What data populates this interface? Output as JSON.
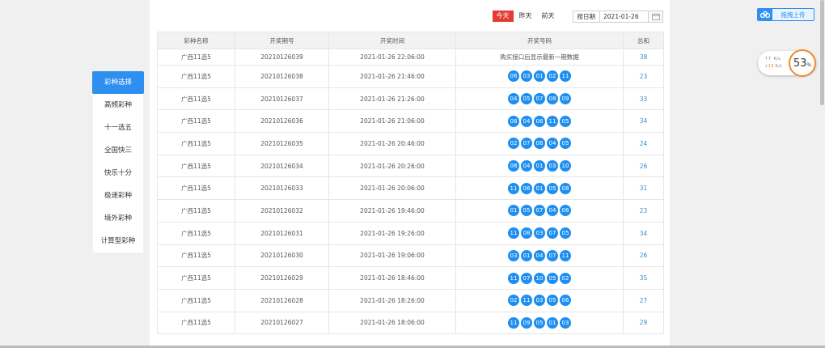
{
  "nav": {
    "items": [
      {
        "label": "彩种选择",
        "active": true
      },
      {
        "label": "高频彩种",
        "active": false
      },
      {
        "label": "十一选五",
        "active": false
      },
      {
        "label": "全国快三",
        "active": false
      },
      {
        "label": "快乐十分",
        "active": false
      },
      {
        "label": "极速彩种",
        "active": false
      },
      {
        "label": "境外彩种",
        "active": false
      },
      {
        "label": "计算型彩种",
        "active": false
      }
    ]
  },
  "toolbar": {
    "today": "今天",
    "yesterday": "昨天",
    "day_before": "前天",
    "date_label": "按日期",
    "date_value": "2021-01-26"
  },
  "table": {
    "headers": [
      "彩种名称",
      "开奖期号",
      "开奖时间",
      "开奖号码",
      "总和"
    ],
    "pending_note": "购买接口后显示最新一期数据",
    "rows": [
      {
        "name": "广西11选5",
        "issue": "20210126039",
        "time": "2021-01-26 22:06:00",
        "balls": [],
        "sum": "38"
      },
      {
        "name": "广西11选5",
        "issue": "20210126038",
        "time": "2021-01-26 21:46:00",
        "balls": [
          "06",
          "03",
          "01",
          "02",
          "11"
        ],
        "sum": "23"
      },
      {
        "name": "广西11选5",
        "issue": "20210126037",
        "time": "2021-01-26 21:26:00",
        "balls": [
          "04",
          "05",
          "07",
          "08",
          "09"
        ],
        "sum": "33"
      },
      {
        "name": "广西11选5",
        "issue": "20210126036",
        "time": "2021-01-26 21:06:00",
        "balls": [
          "08",
          "04",
          "06",
          "11",
          "05"
        ],
        "sum": "34"
      },
      {
        "name": "广西11选5",
        "issue": "20210126035",
        "time": "2021-01-26 20:46:00",
        "balls": [
          "02",
          "07",
          "06",
          "04",
          "05"
        ],
        "sum": "24"
      },
      {
        "name": "广西11选5",
        "issue": "20210126034",
        "time": "2021-01-26 20:26:00",
        "balls": [
          "08",
          "04",
          "01",
          "03",
          "10"
        ],
        "sum": "26"
      },
      {
        "name": "广西11选5",
        "issue": "20210126033",
        "time": "2021-01-26 20:06:00",
        "balls": [
          "11",
          "06",
          "01",
          "05",
          "08"
        ],
        "sum": "31"
      },
      {
        "name": "广西11选5",
        "issue": "20210126032",
        "time": "2021-01-26 19:46:00",
        "balls": [
          "01",
          "05",
          "07",
          "04",
          "06"
        ],
        "sum": "23"
      },
      {
        "name": "广西11选5",
        "issue": "20210126031",
        "time": "2021-01-26 19:26:00",
        "balls": [
          "11",
          "08",
          "03",
          "07",
          "05"
        ],
        "sum": "34"
      },
      {
        "name": "广西11选5",
        "issue": "20210126030",
        "time": "2021-01-26 19:06:00",
        "balls": [
          "03",
          "01",
          "04",
          "07",
          "11"
        ],
        "sum": "26"
      },
      {
        "name": "广西11选5",
        "issue": "20210126029",
        "time": "2021-01-26 18:46:00",
        "balls": [
          "11",
          "07",
          "10",
          "05",
          "02"
        ],
        "sum": "35"
      },
      {
        "name": "广西11选5",
        "issue": "20210126028",
        "time": "2021-01-26 18:26:00",
        "balls": [
          "02",
          "11",
          "03",
          "05",
          "06"
        ],
        "sum": "27"
      },
      {
        "name": "广西11选5",
        "issue": "20210126027",
        "time": "2021-01-26 18:06:00",
        "balls": [
          "11",
          "09",
          "05",
          "01",
          "03"
        ],
        "sum": "29"
      }
    ]
  },
  "upload": {
    "label": "拖拽上传"
  },
  "speed": {
    "up": "7",
    "up_unit": "K/s",
    "down": "13",
    "down_unit": "K/s",
    "cpu": "53",
    "cpu_unit": "%"
  },
  "colors": {
    "accent": "#2e8ff0",
    "ball": "#1e8ff0",
    "today": "#e33b36",
    "cpu_ring": "#f08a30"
  }
}
